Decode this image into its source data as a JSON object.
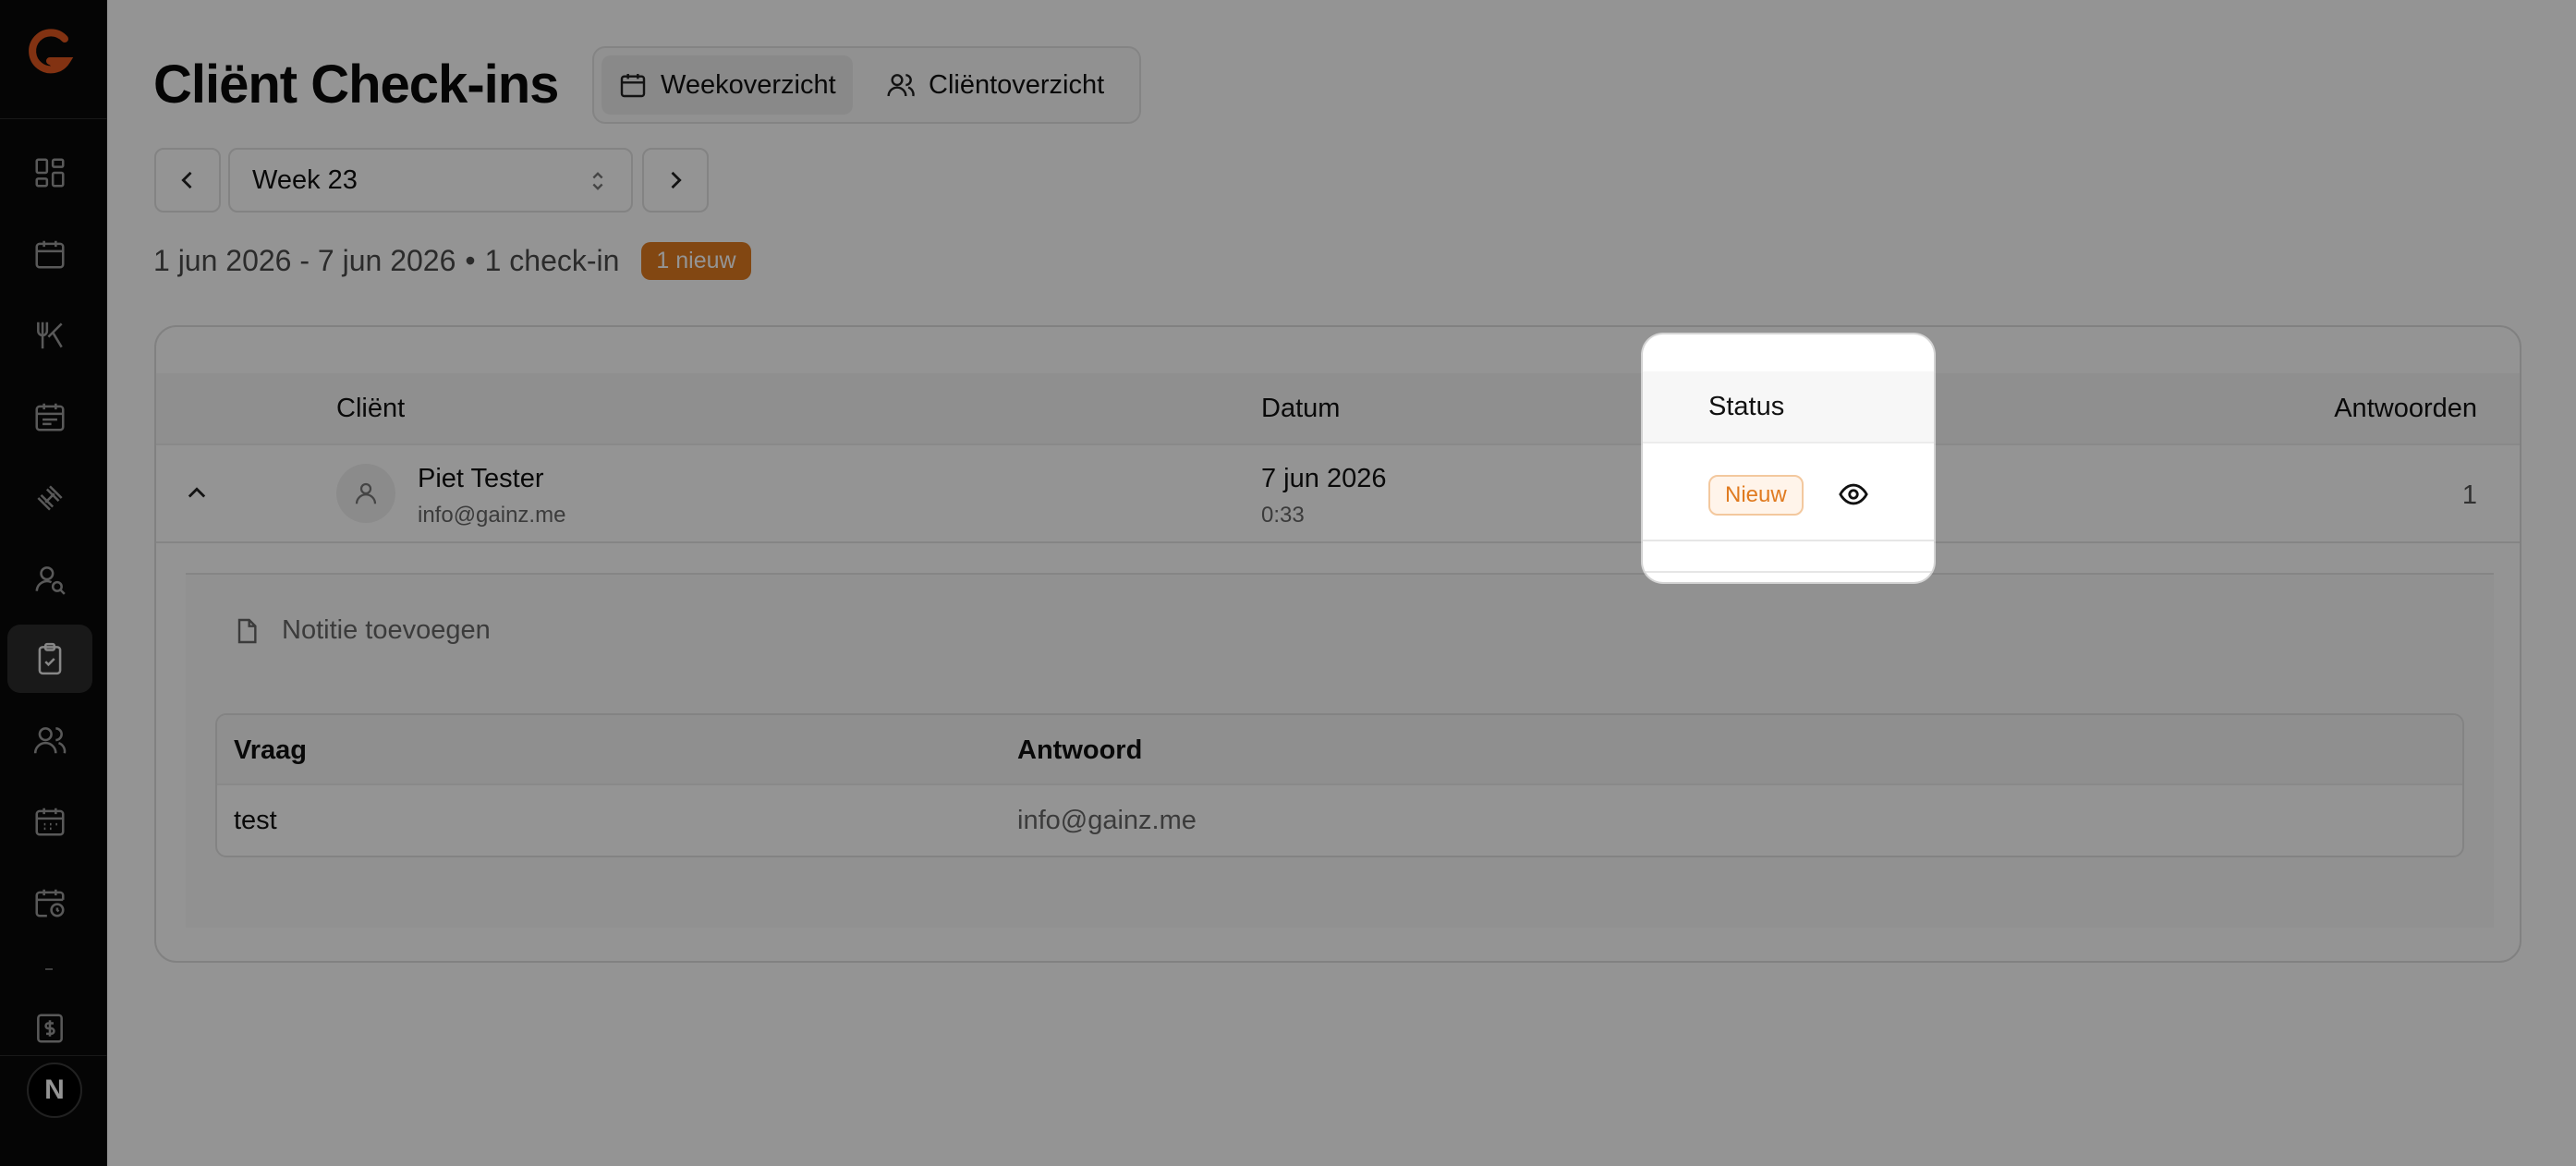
{
  "page": {
    "title": "Cliënt Check-ins"
  },
  "views": {
    "week_label": "Weekoverzicht",
    "client_label": "Cliëntoverzicht"
  },
  "week": {
    "selected": "Week 23"
  },
  "summary": {
    "range": "1 jun 2026 - 7 jun 2026",
    "separator": "•",
    "count": "1 check-in",
    "new_badge": "1 nieuw"
  },
  "table": {
    "headers": {
      "client": "Cliënt",
      "date": "Datum",
      "status": "Status",
      "answers": "Antwoorden"
    },
    "rows": [
      {
        "name": "Piet Tester",
        "email": "info@gainz.me",
        "date": "7 jun 2026",
        "time": "0:33",
        "status": "Nieuw",
        "answers": "1"
      }
    ]
  },
  "detail": {
    "add_note": "Notitie toevoegen",
    "qa_headers": {
      "question": "Vraag",
      "answer": "Antwoord"
    },
    "qa_rows": [
      {
        "question": "test",
        "answer": "info@gainz.me"
      }
    ]
  },
  "sidebar": {
    "avatar_initial": "N",
    "icons": [
      "dashboard-icon",
      "calendar-icon",
      "utensils-icon",
      "calendar-list-icon",
      "dumbbell-icon",
      "user-search-icon",
      "clipboard-check-icon",
      "users-icon",
      "calendar-grid-icon",
      "calendar-clock-icon",
      "dollar-receipt-icon"
    ]
  },
  "colors": {
    "accent": "#e07a1f",
    "sidebar_bg": "#0a0a0a"
  }
}
